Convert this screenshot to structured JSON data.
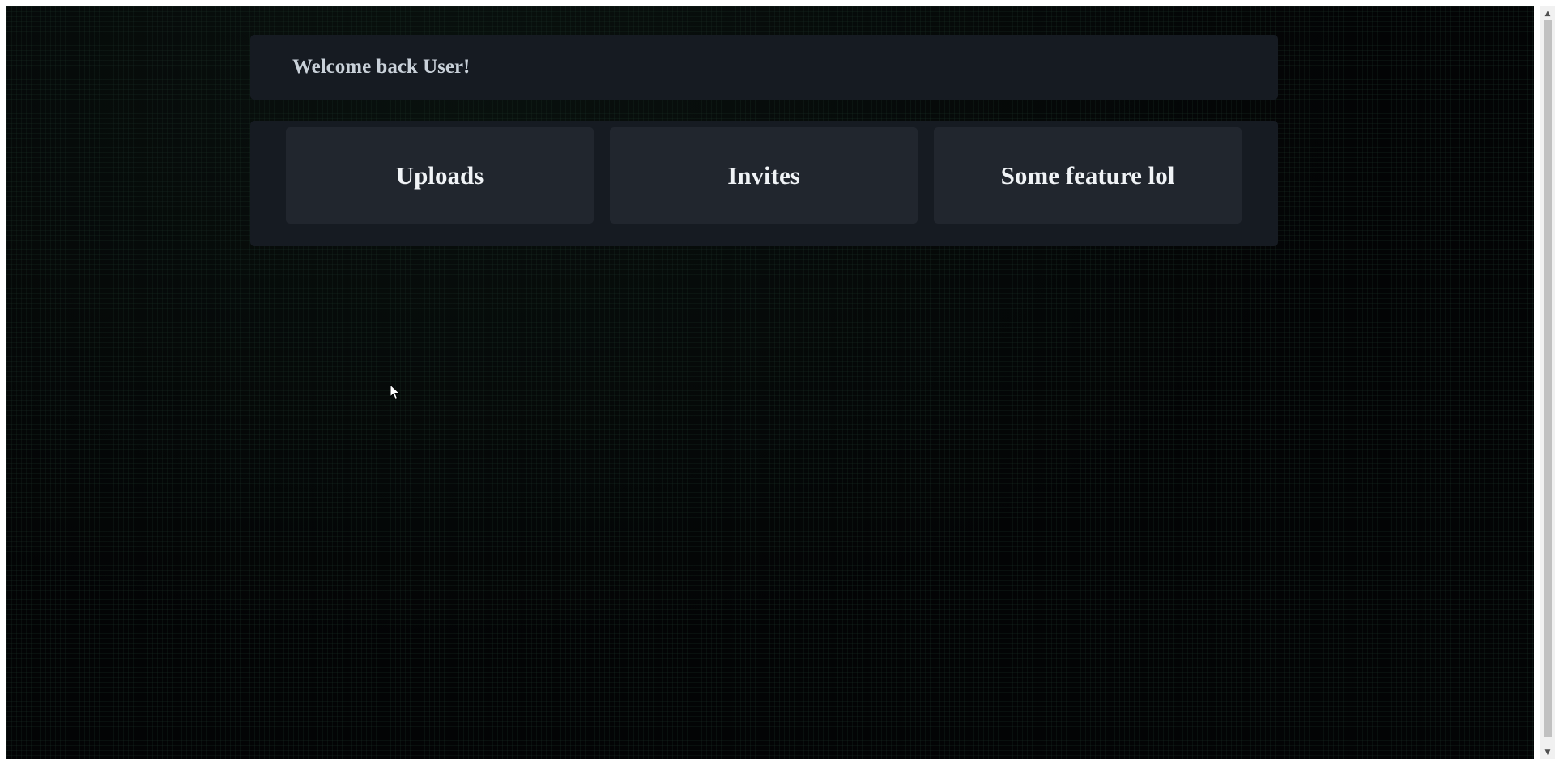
{
  "header": {
    "welcome_text": "Welcome back User!"
  },
  "features": {
    "items": [
      {
        "label": "Uploads"
      },
      {
        "label": "Invites"
      },
      {
        "label": "Some feature lol"
      }
    ]
  },
  "scrollbar": {
    "up_icon": "scroll-up-arrow-icon",
    "down_icon": "scroll-down-arrow-icon"
  },
  "colors": {
    "page_background": "#030405",
    "panel_background": "#161b22",
    "card_background": "#21262e",
    "welcome_text": "#c9d1d9",
    "card_text": "#f0f3f6"
  }
}
